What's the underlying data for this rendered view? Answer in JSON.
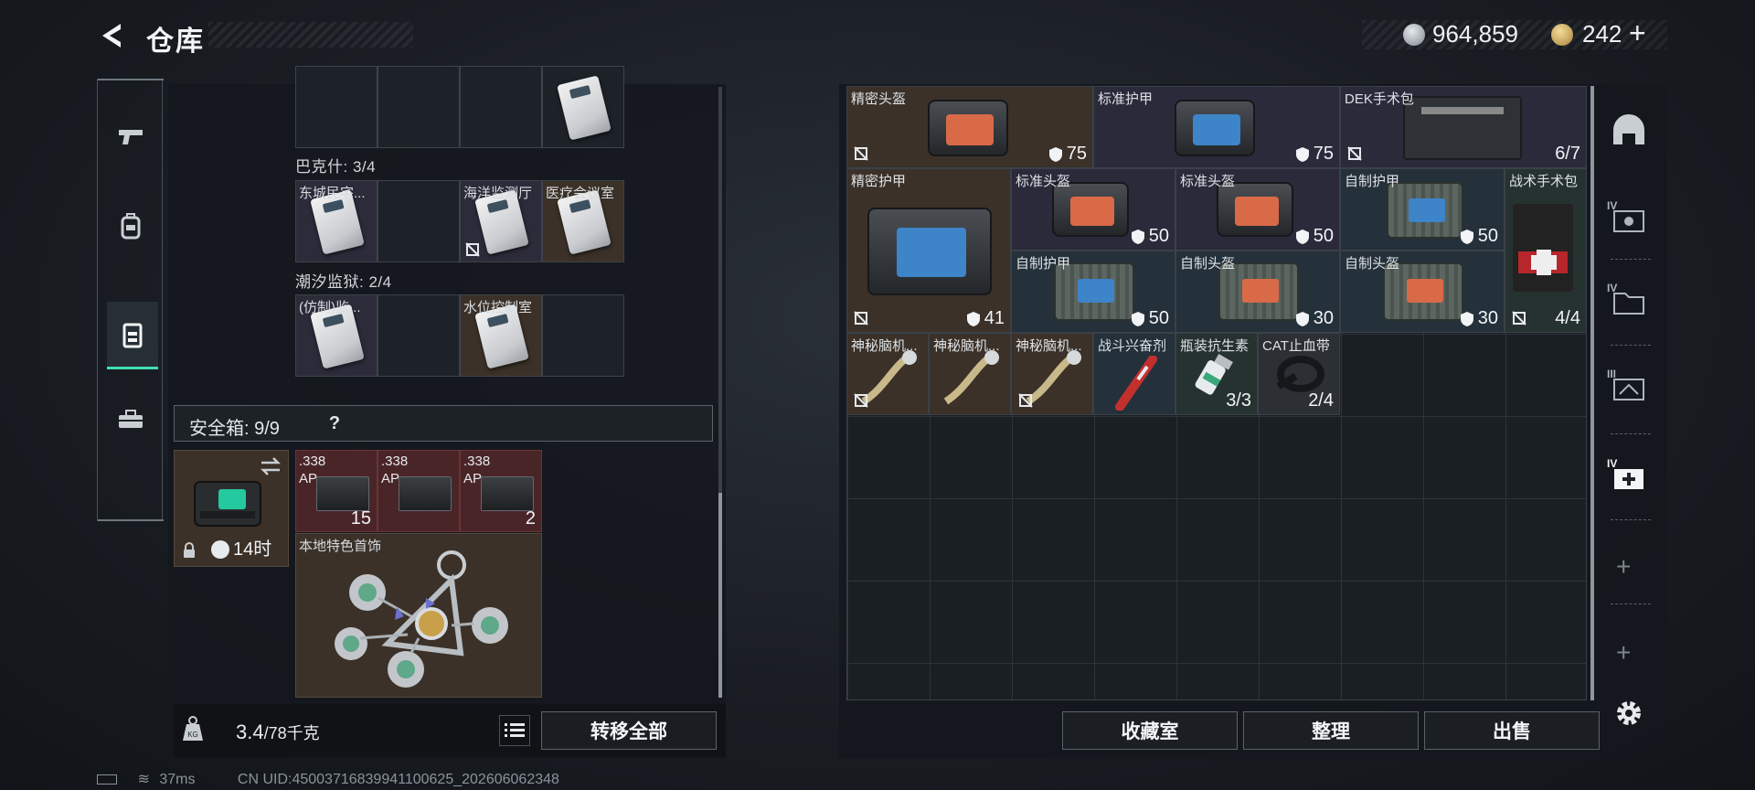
{
  "header": {
    "title": "仓库",
    "currency": {
      "silver": "964,859",
      "gold": "242",
      "plus": "+"
    }
  },
  "left_tabs": [
    "pistol-icon",
    "backpack-icon",
    "vest-icon",
    "toolbox-icon"
  ],
  "key_sections": [
    {
      "label": "巴克什: 3/4"
    },
    {
      "label": "潮汐监狱: 2/4"
    }
  ],
  "keys": {
    "row_top": [],
    "bakeshi": [
      "东城民宅...",
      "海洋监测厅",
      "医疗会议室"
    ],
    "prison": [
      "(仿制)监...",
      "水位控制室"
    ]
  },
  "safebox": {
    "label": "安全箱: 9/9",
    "help": "?",
    "time": "14时"
  },
  "ammo": [
    {
      "label": ".338\nAP",
      "qty": "15"
    },
    {
      "label": ".338\nAP",
      "qty": ""
    },
    {
      "label": ".338\nAP",
      "qty": "2"
    }
  ],
  "charm": {
    "label": "本地特色首饰"
  },
  "weight": {
    "current": "3.4",
    "max": "/78千克"
  },
  "transfer_all": "转移全部",
  "status": {
    "ping": "37ms",
    "uid": "CN UID:45003716839941100625_202606062348"
  },
  "stash_items": [
    {
      "name": "精密头盔",
      "val": "75"
    },
    {
      "name": "标准护甲",
      "val": "75"
    },
    {
      "name": "DEK手术包",
      "val": "6/7"
    },
    {
      "name": "精密护甲",
      "val": "41"
    },
    {
      "name": "标准头盔",
      "val": "50"
    },
    {
      "name": "标准头盔",
      "val": "50"
    },
    {
      "name": "自制护甲",
      "val": "50"
    },
    {
      "name": "战术手术包",
      "val": "4/4"
    },
    {
      "name": "自制护甲",
      "val": "50"
    },
    {
      "name": "自制头盔",
      "val": "30"
    },
    {
      "name": "自制头盔",
      "val": "30"
    },
    {
      "name": "神秘脑机...",
      "val": ""
    },
    {
      "name": "神秘脑机...",
      "val": ""
    },
    {
      "name": "神秘脑机...",
      "val": ""
    },
    {
      "name": "战斗兴奋剂",
      "val": ""
    },
    {
      "name": "瓶装抗生素",
      "val": "3/3"
    },
    {
      "name": "CAT止血带",
      "val": "2/4"
    }
  ],
  "stash_buttons": [
    "收藏室",
    "整理",
    "出售"
  ],
  "right_tabs": [
    {
      "icon": "helmet-tab-icon",
      "num": ""
    },
    {
      "icon": "case-iv-icon",
      "num": "IV"
    },
    {
      "icon": "folder-iv-icon",
      "num": "IV"
    },
    {
      "icon": "box-iii-icon",
      "num": "III"
    },
    {
      "icon": "medkit-iv-icon",
      "num": "IV"
    }
  ],
  "colors": {
    "accent": "#3fe0b0",
    "brown_cell": "#3b3128",
    "purple_cell": "#2b2a3b",
    "red_cell": "#4a2528"
  }
}
